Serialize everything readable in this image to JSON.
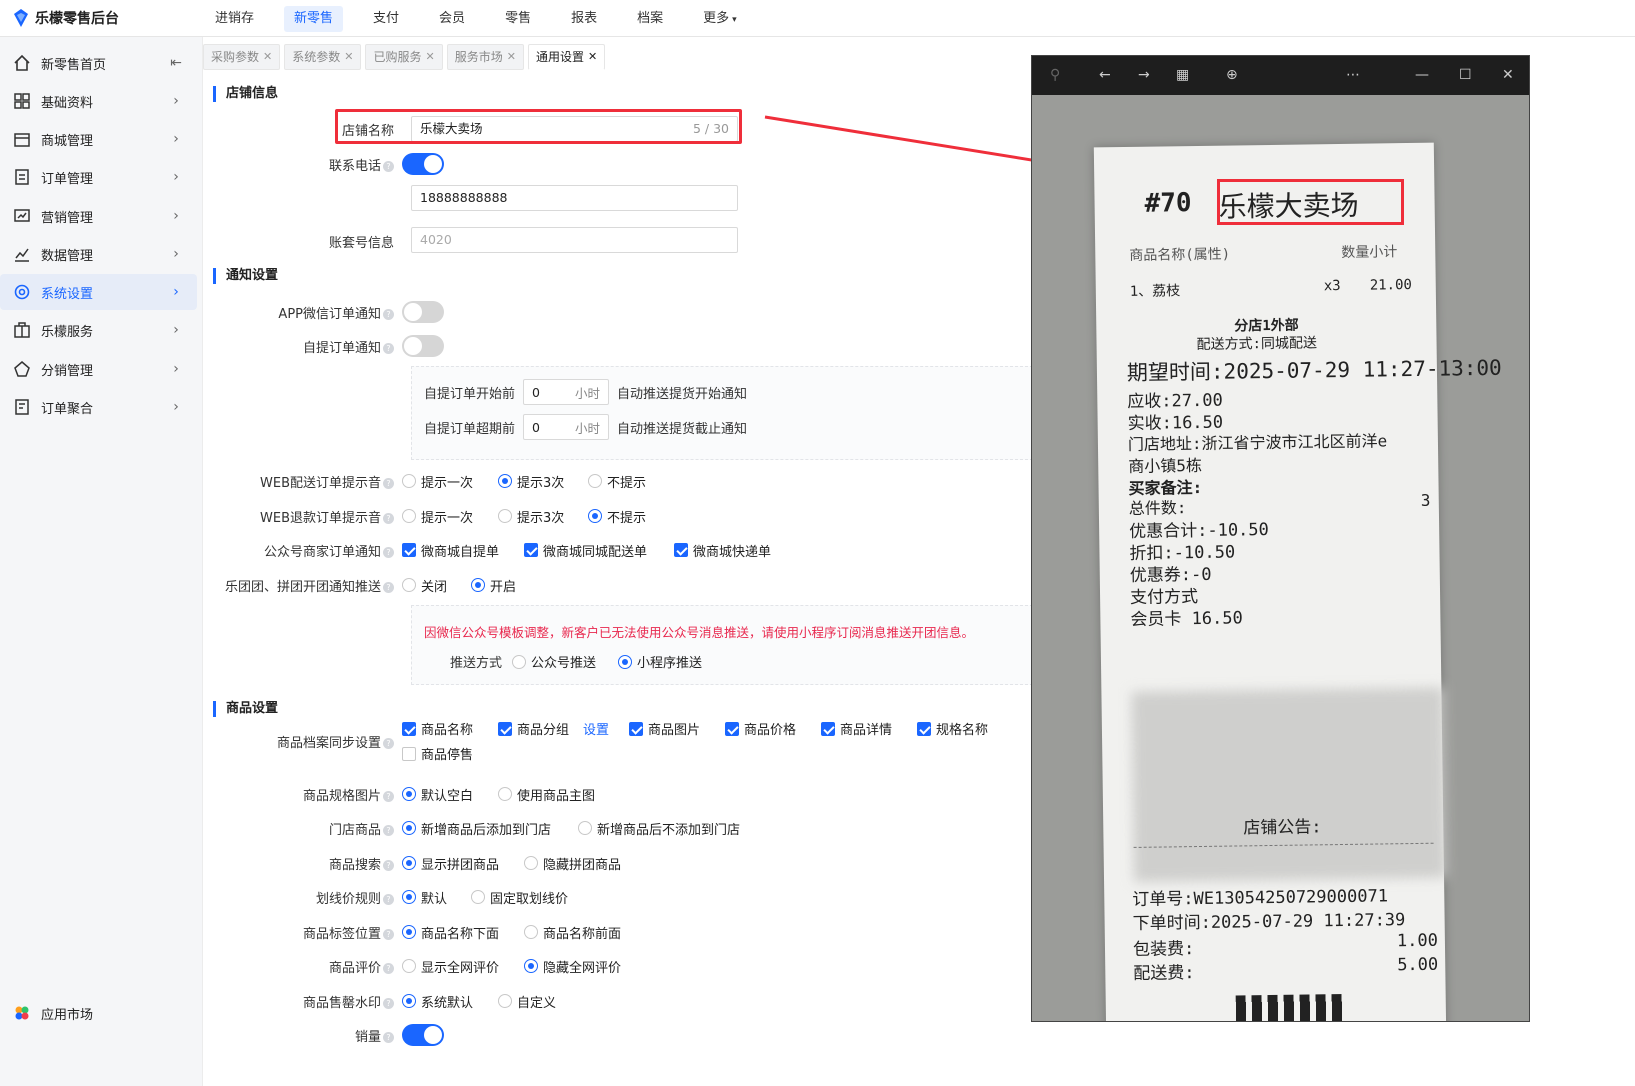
{
  "app": {
    "brand": "乐檬零售后台"
  },
  "topnav": [
    {
      "label": "进销存",
      "active": false
    },
    {
      "label": "新零售",
      "active": true
    },
    {
      "label": "支付",
      "active": false
    },
    {
      "label": "会员",
      "active": false
    },
    {
      "label": "零售",
      "active": false
    },
    {
      "label": "报表",
      "active": false
    },
    {
      "label": "档案",
      "active": false
    },
    {
      "label": "更多",
      "active": false
    }
  ],
  "sidebar": {
    "items": [
      {
        "label": "新零售首页",
        "icon": "home-icon"
      },
      {
        "label": "基础资料",
        "icon": "grid-icon"
      },
      {
        "label": "商城管理",
        "icon": "store-icon"
      },
      {
        "label": "订单管理",
        "icon": "order-icon"
      },
      {
        "label": "营销管理",
        "icon": "marketing-icon"
      },
      {
        "label": "数据管理",
        "icon": "chart-icon"
      },
      {
        "label": "系统设置",
        "icon": "settings-icon"
      },
      {
        "label": "乐檬服务",
        "icon": "service-icon"
      },
      {
        "label": "分销管理",
        "icon": "distribution-icon"
      },
      {
        "label": "订单聚合",
        "icon": "aggregate-icon"
      }
    ],
    "active_index": 6,
    "bottom": {
      "label": "应用市场",
      "icon": "app-market-icon"
    }
  },
  "tabs": [
    {
      "label": "采购参数",
      "active": false
    },
    {
      "label": "系统参数",
      "active": false
    },
    {
      "label": "已购服务",
      "active": false
    },
    {
      "label": "服务市场",
      "active": false
    },
    {
      "label": "通用设置",
      "active": true
    }
  ],
  "form": {
    "sec_store": "店铺信息",
    "store_name_label": "店铺名称",
    "store_name_value": "乐檬大卖场",
    "store_name_count": "5 / 30",
    "phone_label": "联系电话",
    "phone_toggle": true,
    "phone_value": "18888888888",
    "account_label": "账套号信息",
    "account_placeholder": "4020",
    "sec_notify": "通知设置",
    "app_wechat_label": "APP微信订单通知",
    "app_wechat_toggle": false,
    "pickup_label": "自提订单通知",
    "pickup_toggle": false,
    "pickup_start_label": "自提订单开始前",
    "pickup_start_value": "0",
    "pickup_start_unit": "小时",
    "pickup_start_desc": "自动推送提货开始通知",
    "pickup_end_label": "自提订单超期前",
    "pickup_end_value": "0",
    "pickup_end_unit": "小时",
    "pickup_end_desc": "自动推送提货截止通知",
    "web_delivery_label": "WEB配送订单提示音",
    "web_delivery_options": [
      "提示一次",
      "提示3次",
      "不提示"
    ],
    "web_delivery_selected": 1,
    "web_refund_label": "WEB退款订单提示音",
    "web_refund_options": [
      "提示一次",
      "提示3次",
      "不提示"
    ],
    "web_refund_selected": 2,
    "oa_label": "公众号商家订单通知",
    "oa_options": [
      "微商城自提单",
      "微商城同城配送单",
      "微商城快递单"
    ],
    "group_label": "乐团团、拼团开团通知推送",
    "group_options": [
      "关闭",
      "开启"
    ],
    "group_selected": 1,
    "group_note": "因微信公众号模板调整，新客户已无法使用公众号消息推送，请使用小程序订阅消息推送开团信息。",
    "push_label": "推送方式",
    "push_options": [
      "公众号推送",
      "小程序推送"
    ],
    "push_selected": 1,
    "sec_goods": "商品设置",
    "sync_label": "商品档案同步设置",
    "sync_options": [
      "商品名称",
      "商品分组",
      "商品图片",
      "商品价格",
      "商品详情",
      "规格名称",
      "商品停售"
    ],
    "sync_link": "设置",
    "spec_img_label": "商品规格图片",
    "spec_img_options": [
      "默认空白",
      "使用商品主图"
    ],
    "spec_img_selected": 0,
    "store_goods_label": "门店商品",
    "store_goods_options": [
      "新增商品后添加到门店",
      "新增商品后不添加到门店"
    ],
    "store_goods_selected": 0,
    "search_label": "商品搜索",
    "search_options": [
      "显示拼团商品",
      "隐藏拼团商品"
    ],
    "search_selected": 0,
    "strike_label": "划线价规则",
    "strike_options": [
      "默认",
      "固定取划线价"
    ],
    "strike_selected": 0,
    "tag_label": "商品标签位置",
    "tag_options": [
      "商品名称下面",
      "商品名称前面"
    ],
    "tag_selected": 0,
    "review_label": "商品评价",
    "review_options": [
      "显示全网评价",
      "隐藏全网评价"
    ],
    "review_selected": 1,
    "soldout_label": "商品售罄水印",
    "soldout_options": [
      "系统默认",
      "自定义"
    ],
    "soldout_selected": 0,
    "sales_label": "销量",
    "sales_toggle": true
  },
  "receipt": {
    "header_no": "#70",
    "header_name": "乐檬大卖场",
    "col_left": "商品名称(属性)",
    "col_right": "数量小计",
    "item": "1、荔枝",
    "item_qty": "x3",
    "item_sub": "21.00",
    "branch": "分店1外部",
    "delivery": "配送方式:同城配送",
    "expect": "期望时间:2025-07-29 11:27-13:00",
    "due": "应收:27.00",
    "paid": "实收:16.50",
    "addr1": "门店地址:浙江省宁波市江北区前洋e",
    "addr2": "商小镇5栋",
    "buyer_note": "买家备注:",
    "total_count": "总件数:",
    "total_count_val": "3",
    "discount_total": "优惠合计:-10.50",
    "discount": "折扣:-10.50",
    "coupon": "优惠券:-0",
    "pay_method": "支付方式",
    "member_card": "会员卡 16.50",
    "notice": "店铺公告:",
    "order_no": "订单号:WE13054250729000071",
    "order_time": "下单时间:2025-07-29 11:27:39",
    "pack_fee": "包装费:",
    "pack_fee_val": "1.00",
    "ship_fee": "配送费:",
    "ship_fee_val": "5.00"
  },
  "colors": {
    "accent": "#1a66ff",
    "highlight": "#ef2e3a",
    "warn_text": "#e8284e"
  }
}
